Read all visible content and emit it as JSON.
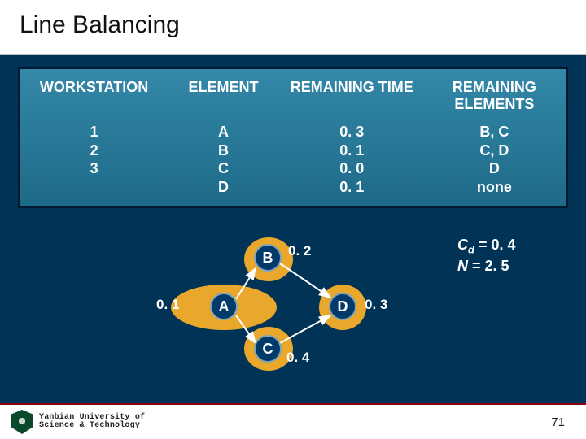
{
  "title": "Line Balancing",
  "table": {
    "headers": [
      "WORKSTATION",
      "ELEMENT",
      "REMAINING TIME",
      "REMAINING ELEMENTS"
    ],
    "rows": [
      {
        "workstation": "1",
        "element": "A",
        "remaining_time": "0. 3",
        "remaining_elements": "B, C"
      },
      {
        "workstation": "",
        "element": "B",
        "remaining_time": "0. 1",
        "remaining_elements": "C, D"
      },
      {
        "workstation": "2",
        "element": "C",
        "remaining_time": "0. 0",
        "remaining_elements": "D"
      },
      {
        "workstation": "3",
        "element": "D",
        "remaining_time": "0. 1",
        "remaining_elements": "none"
      }
    ]
  },
  "chart_data": {
    "type": "graph",
    "nodes": [
      {
        "id": "A",
        "duration": 0.1
      },
      {
        "id": "B",
        "duration": 0.2
      },
      {
        "id": "C",
        "duration": 0.4
      },
      {
        "id": "D",
        "duration": 0.3
      }
    ],
    "edges": [
      {
        "from": "A",
        "to": "B"
      },
      {
        "from": "A",
        "to": "C"
      },
      {
        "from": "B",
        "to": "D"
      },
      {
        "from": "C",
        "to": "D"
      }
    ],
    "node_labels": {
      "A": "0. 1",
      "B": "0. 2",
      "C": "0. 4",
      "D": "0. 3"
    },
    "clusters": [
      {
        "station": 1,
        "members": [
          "A",
          "B"
        ]
      },
      {
        "station": 2,
        "members": [
          "C"
        ]
      },
      {
        "station": 3,
        "members": [
          "D"
        ]
      }
    ]
  },
  "params": {
    "cd_label": "C",
    "cd_sub": "d",
    "cd_eq": " = ",
    "cd_val": "0. 4",
    "n_label": "N",
    "n_eq": " = ",
    "n_val": "2. 5"
  },
  "footer": {
    "uni_line1": "Yanbian University of",
    "uni_line2": "Science & Technology",
    "page": "71"
  }
}
